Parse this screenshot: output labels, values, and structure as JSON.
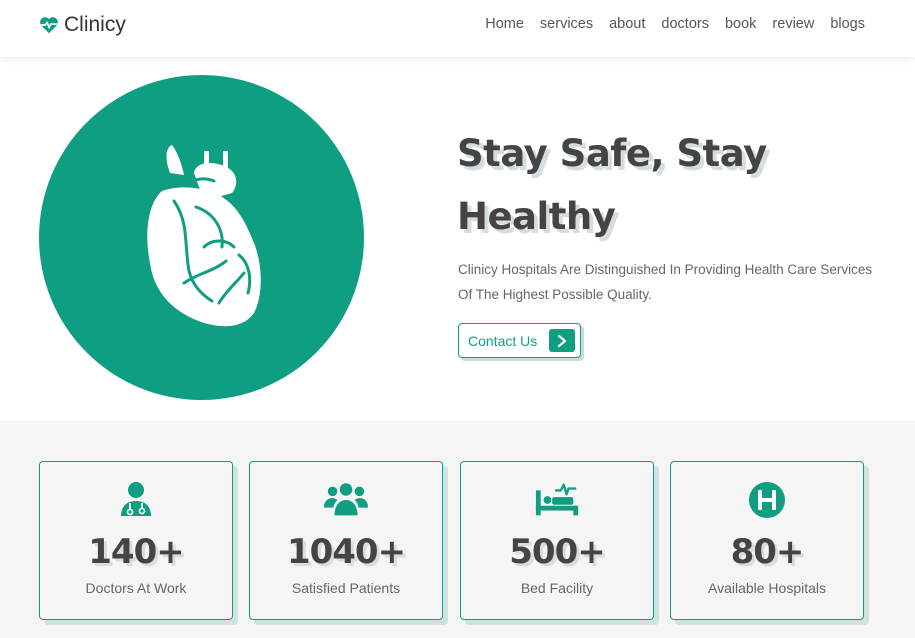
{
  "brand": {
    "name": "Clinicy",
    "accent": "#109e83",
    "icon": "heartbeat-icon"
  },
  "nav": [
    {
      "label": "Home"
    },
    {
      "label": "services"
    },
    {
      "label": "about"
    },
    {
      "label": "doctors"
    },
    {
      "label": "book"
    },
    {
      "label": "review"
    },
    {
      "label": "blogs"
    }
  ],
  "hero": {
    "image_icon": "human-heart-icon",
    "title": "Stay Safe, Stay Healthy",
    "description": "Clinicy Hospitals Are Distinguished In Providing Health Care Services Of The Highest Possible Quality.",
    "cta_label": "Contact Us",
    "cta_icon": "chevron-right-icon"
  },
  "stats": [
    {
      "icon": "doctor-icon",
      "value": "140+",
      "label": "Doctors At Work"
    },
    {
      "icon": "users-icon",
      "value": "1040+",
      "label": "Satisfied Patients"
    },
    {
      "icon": "procedures-bed-icon",
      "value": "500+",
      "label": "Bed Facility"
    },
    {
      "icon": "hospital-h-icon",
      "value": "80+",
      "label": "Available Hospitals"
    }
  ]
}
